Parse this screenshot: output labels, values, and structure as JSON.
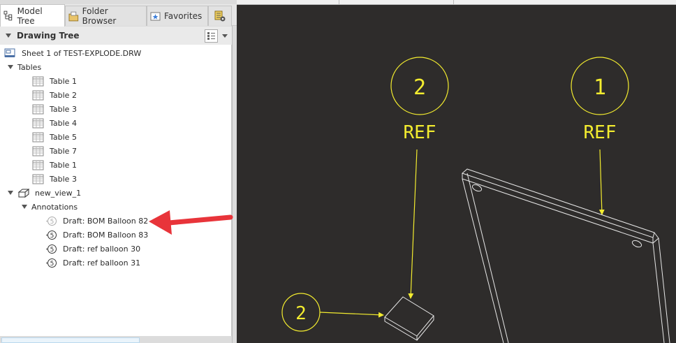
{
  "tabs": [
    {
      "label": "Model Tree",
      "icon": "model-tree-icon",
      "active": true
    },
    {
      "label": "Folder Browser",
      "icon": "folder-browser-icon",
      "active": false
    },
    {
      "label": "Favorites",
      "icon": "favorites-icon",
      "active": false
    },
    {
      "label": "",
      "icon": "layer-settings-icon",
      "active": false
    }
  ],
  "tree": {
    "header_title": "Drawing Tree",
    "sheet": "Sheet 1 of TEST-EXPLODE.DRW",
    "tables_label": "Tables",
    "tables": [
      "Table 1",
      "Table 2",
      "Table 3",
      "Table 4",
      "Table 5",
      "Table 7",
      "Table 1",
      "Table 3"
    ],
    "view_label": "new_view_1",
    "annotations_label": "Annotations",
    "annotations": [
      "Draft: BOM Balloon 82",
      "Draft: BOM Balloon 83",
      "Draft: ref balloon 30",
      "Draft: ref balloon 31"
    ]
  },
  "drawing": {
    "balloons": [
      {
        "number": "2",
        "ref": "REF"
      },
      {
        "number": "1",
        "ref": "REF"
      },
      {
        "number": "2",
        "ref": ""
      }
    ],
    "line_color": "#f3ec2f",
    "edge_color": "#e8e8e8",
    "background": "#2e2c2b"
  },
  "callout": {
    "color": "#e8343a"
  }
}
